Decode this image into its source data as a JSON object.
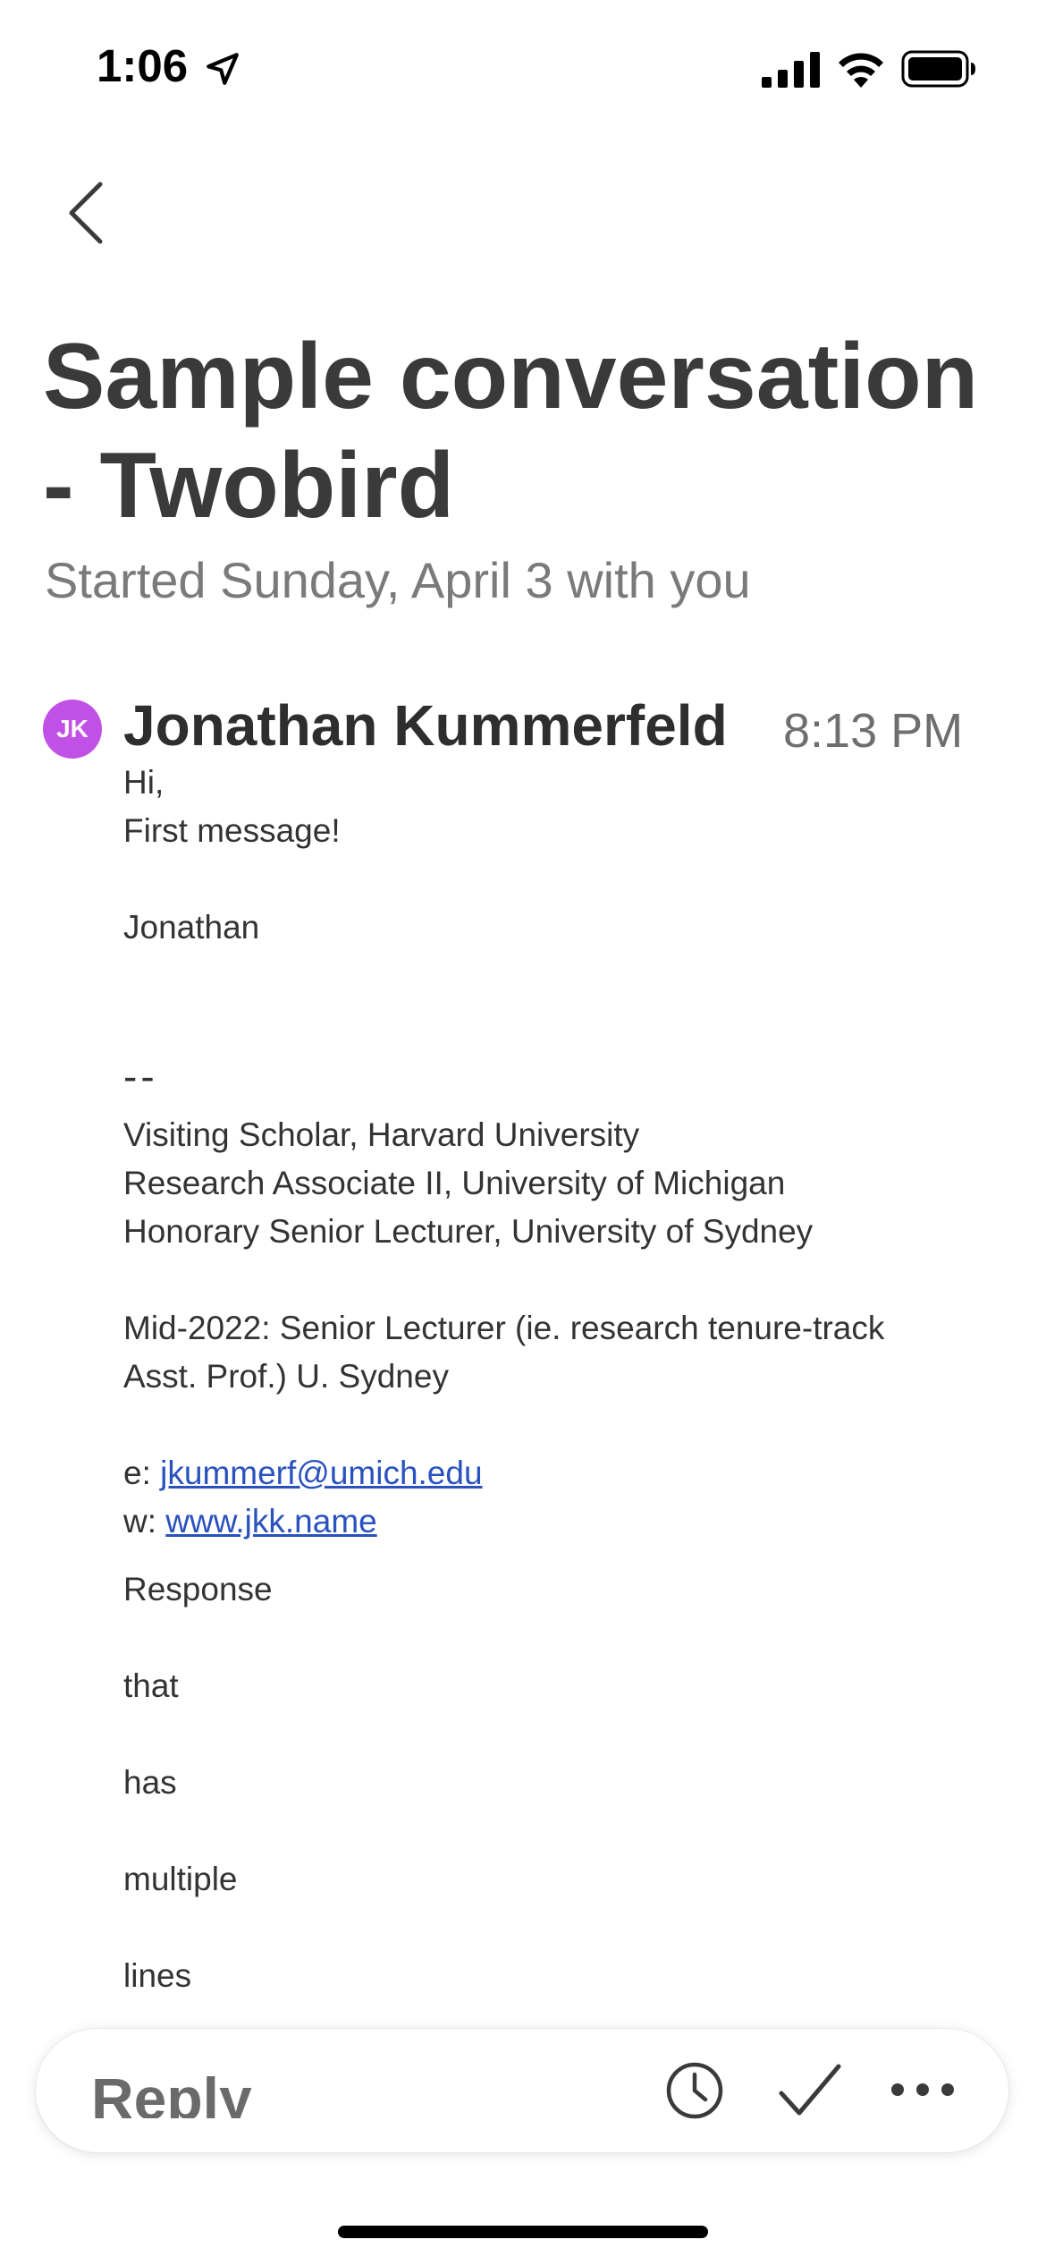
{
  "status_bar": {
    "time": "1:06",
    "icons": [
      "location-arrow-icon",
      "cellular-signal-icon",
      "wifi-icon",
      "battery-icon"
    ]
  },
  "header": {
    "back_icon": "chevron-left-icon",
    "title": "Sample conversation - Twobird",
    "subtitle": "Started Sunday, April 3 with you"
  },
  "message": {
    "avatar_initials": "JK",
    "avatar_color": "#c151e6",
    "sender": "Jonathan Kummerfeld",
    "time": "8:13 PM",
    "body": {
      "greeting": "Hi,",
      "line1": "First message!",
      "signoff": "Jonathan",
      "sig_separator": "--",
      "sig_line1": "Visiting Scholar, Harvard University",
      "sig_line2": "Research Associate II, University of Michigan",
      "sig_line3": "Honorary Senior Lecturer, University of Sydney",
      "sig_line4": "Mid-2022: Senior Lecturer (ie. research tenure-track",
      "sig_line5": "Asst. Prof.) U. Sydney",
      "email_prefix": "e: ",
      "email": "jkummerf@umich.edu",
      "web_prefix": "w: ",
      "web": "www.jkk.name"
    },
    "response_lines": [
      "Response",
      "that",
      "has",
      "multiple",
      "lines"
    ]
  },
  "reply_bar": {
    "reply_label": "Reply",
    "snooze_icon": "clock-icon",
    "done_icon": "checkmark-icon",
    "more_icon": "more-horizontal-icon"
  },
  "colors": {
    "link": "#2a52be",
    "title": "#3a3a3a",
    "subtitle": "#7a7a7a"
  }
}
